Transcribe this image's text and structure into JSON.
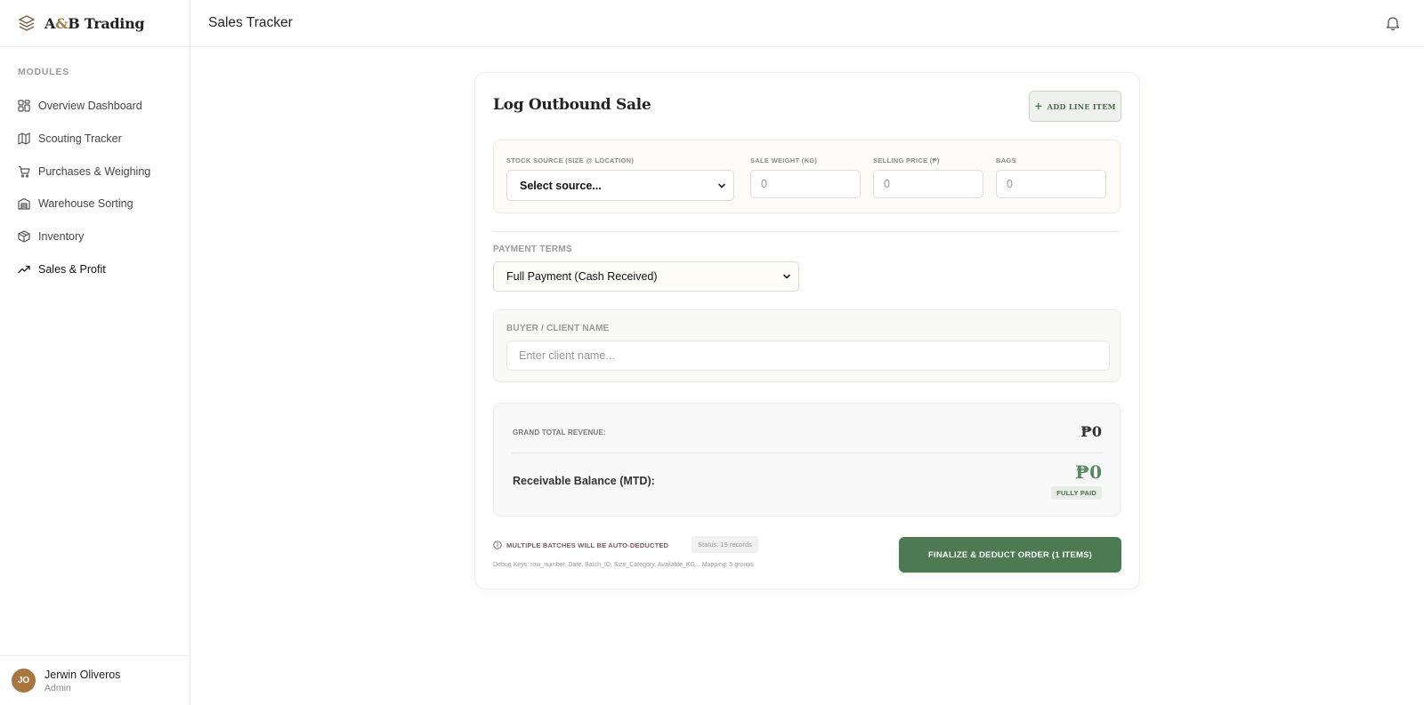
{
  "brand": {
    "name_prefix": "A",
    "name_amp": "&",
    "name_suffix": "B Trading",
    "icon": "layers-icon"
  },
  "sidebar": {
    "section_label": "MODULES",
    "items": [
      {
        "label": "Overview Dashboard",
        "icon": "grid-icon"
      },
      {
        "label": "Scouting Tracker",
        "icon": "map-icon"
      },
      {
        "label": "Purchases & Weighing",
        "icon": "cart-icon"
      },
      {
        "label": "Warehouse Sorting",
        "icon": "warehouse-icon"
      },
      {
        "label": "Inventory",
        "icon": "box-icon"
      },
      {
        "label": "Sales & Profit",
        "icon": "trend-up-icon",
        "active": true
      }
    ]
  },
  "user": {
    "initials": "JO",
    "name": "Jerwin Oliveros",
    "role": "Admin"
  },
  "header": {
    "title": "Sales Tracker",
    "notification_icon": "bell-icon"
  },
  "form": {
    "title": "Log Outbound Sale",
    "add_line_label": "ADD LINE ITEM",
    "line_item": {
      "source_label": "STOCK SOURCE (SIZE @ LOCATION)",
      "source_value": "Select source...",
      "weight_label": "SALE WEIGHT (KG)",
      "weight_placeholder": "0",
      "price_label": "SELLING PRICE (₱)",
      "price_placeholder": "0",
      "bags_label": "BAGS",
      "bags_placeholder": "0"
    },
    "payment": {
      "label": "PAYMENT TERMS",
      "value": "Full Payment (Cash Received)"
    },
    "buyer": {
      "label": "BUYER / CLIENT NAME",
      "placeholder": "Enter client name..."
    },
    "totals": {
      "grand_total_label": "GRAND TOTAL REVENUE:",
      "grand_total_value": "₱0",
      "receivable_label": "Receivable Balance (MTD):",
      "receivable_value": "₱0",
      "status_badge": "FULLY PAID"
    },
    "footer": {
      "warning": "MULTIPLE BATCHES WILL BE AUTO-DEDUCTED",
      "status_chip": "Status: 19 records",
      "debug": "Debug Keys: row_number, Date, Batch_ID, Size_Category, Available_KG... Mapping: 5 groups",
      "finalize_label": "FINALIZE & DEDUCT ORDER (1 ITEMS)"
    }
  },
  "colors": {
    "accent_green": "#4d7a52",
    "brand_gold": "#a27843",
    "avatar": "#a8763e"
  }
}
